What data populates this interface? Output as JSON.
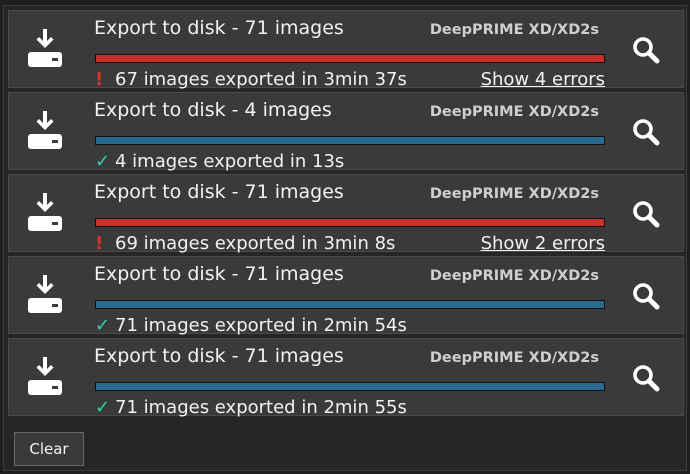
{
  "colors": {
    "error_bar": "#c8312b",
    "success_bar": "#2a6a92",
    "error_mark": "#d9322c",
    "success_mark": "#2fd1a6"
  },
  "icons": {
    "export": "export-to-disk-icon",
    "search": "magnifier-icon",
    "error": "exclamation-icon",
    "success": "checkmark-icon"
  },
  "jobs": [
    {
      "title": "Export to disk - 71 images",
      "preset": "DeepPRIME XD/XD2s",
      "state": "error",
      "mark": "!",
      "status": "67 images exported in 3min 37s",
      "errors_link": "Show 4 errors"
    },
    {
      "title": "Export to disk - 4 images",
      "preset": "DeepPRIME XD/XD2s",
      "state": "success",
      "mark": "✓",
      "status": "4 images exported in 13s",
      "errors_link": ""
    },
    {
      "title": "Export to disk - 71 images",
      "preset": "DeepPRIME XD/XD2s",
      "state": "error",
      "mark": "!",
      "status": "69 images exported in 3min 8s",
      "errors_link": "Show 2 errors"
    },
    {
      "title": "Export to disk - 71 images",
      "preset": "DeepPRIME XD/XD2s",
      "state": "success",
      "mark": "✓",
      "status": "71 images exported in 2min 54s",
      "errors_link": ""
    },
    {
      "title": "Export to disk - 71 images",
      "preset": "DeepPRIME XD/XD2s",
      "state": "success",
      "mark": "✓",
      "status": "71 images exported in 2min 55s",
      "errors_link": ""
    }
  ],
  "footer": {
    "clear_label": "Clear"
  }
}
